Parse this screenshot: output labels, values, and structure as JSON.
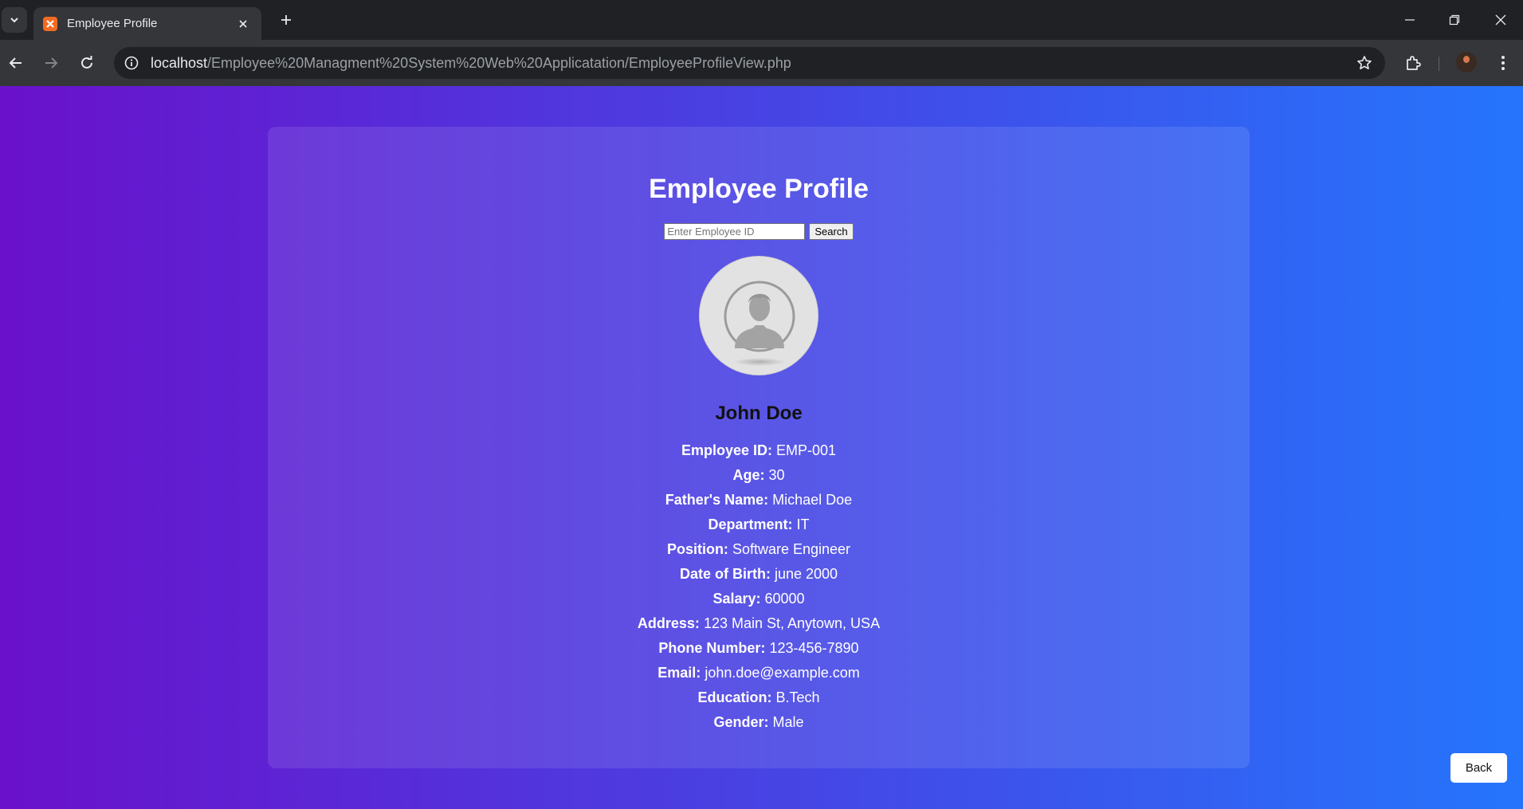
{
  "browser": {
    "tab_title": "Employee Profile",
    "url_host": "localhost",
    "url_path": "/Employee%20Managment%20System%20Web%20Applicatation/EmployeeProfileView.php"
  },
  "page": {
    "heading": "Employee Profile",
    "search": {
      "placeholder": "Enter Employee ID",
      "value": "",
      "button_label": "Search"
    },
    "employee_name": "John Doe",
    "details": [
      {
        "label": "Employee ID:",
        "value": "EMP-001"
      },
      {
        "label": "Age:",
        "value": "30"
      },
      {
        "label": "Father's Name:",
        "value": "Michael Doe"
      },
      {
        "label": "Department:",
        "value": "IT"
      },
      {
        "label": "Position:",
        "value": "Software Engineer"
      },
      {
        "label": "Date of Birth:",
        "value": "june 2000"
      },
      {
        "label": "Salary:",
        "value": "60000"
      },
      {
        "label": "Address:",
        "value": "123 Main St, Anytown, USA"
      },
      {
        "label": "Phone Number:",
        "value": "123-456-7890"
      },
      {
        "label": "Email:",
        "value": "john.doe@example.com"
      },
      {
        "label": "Education:",
        "value": "B.Tech"
      },
      {
        "label": "Gender:",
        "value": "Male"
      }
    ],
    "back_label": "Back"
  },
  "colors": {
    "gradient_start": "#6a11cb",
    "gradient_end": "#2575fc",
    "favicon": "#f26b21"
  },
  "icons": [
    "tab-list-icon",
    "xampp-favicon-icon",
    "close-icon",
    "plus-icon",
    "minimize-icon",
    "restore-icon",
    "window-close-icon",
    "back-arrow-icon",
    "forward-arrow-icon",
    "reload-icon",
    "site-info-icon",
    "star-icon",
    "extensions-icon",
    "kebab-menu-icon",
    "profile-placeholder-icon"
  ]
}
